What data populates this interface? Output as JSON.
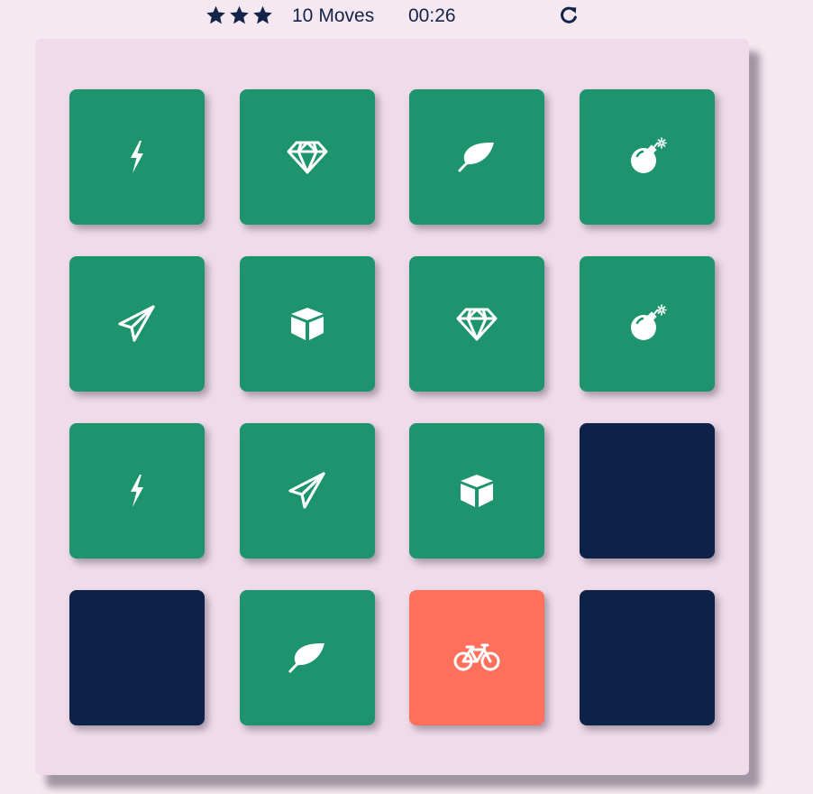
{
  "score_panel": {
    "stars": [
      "star-icon",
      "star-icon",
      "star-icon"
    ],
    "moves_count": "10",
    "moves_label": "Moves",
    "timer": "00:26",
    "restart_icon": "restart-icon"
  },
  "colors": {
    "matched": "#1e946e",
    "hidden": "#0e2248",
    "open": "#fe705b",
    "text": "#13234a"
  },
  "deck": {
    "cards": [
      {
        "state": "match",
        "icon": "bolt"
      },
      {
        "state": "match",
        "icon": "diamond"
      },
      {
        "state": "match",
        "icon": "leaf"
      },
      {
        "state": "match",
        "icon": "bomb"
      },
      {
        "state": "match",
        "icon": "paper-plane"
      },
      {
        "state": "match",
        "icon": "cube"
      },
      {
        "state": "match",
        "icon": "diamond"
      },
      {
        "state": "match",
        "icon": "bomb"
      },
      {
        "state": "match",
        "icon": "bolt"
      },
      {
        "state": "match",
        "icon": "paper-plane"
      },
      {
        "state": "match",
        "icon": "cube"
      },
      {
        "state": "hidden",
        "icon": ""
      },
      {
        "state": "hidden",
        "icon": ""
      },
      {
        "state": "match",
        "icon": "leaf"
      },
      {
        "state": "open",
        "icon": "bicycle"
      },
      {
        "state": "hidden",
        "icon": ""
      }
    ]
  }
}
